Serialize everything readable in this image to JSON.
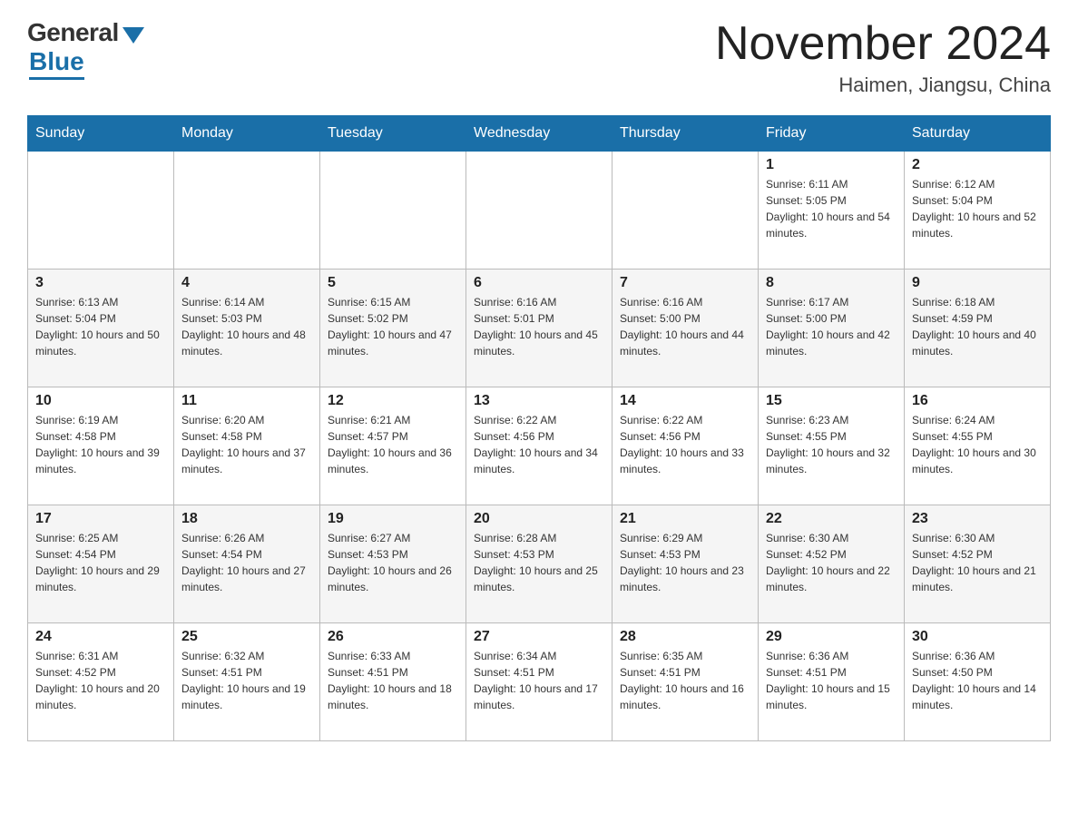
{
  "logo": {
    "general": "General",
    "blue": "Blue"
  },
  "title": "November 2024",
  "location": "Haimen, Jiangsu, China",
  "weekdays": [
    "Sunday",
    "Monday",
    "Tuesday",
    "Wednesday",
    "Thursday",
    "Friday",
    "Saturday"
  ],
  "weeks": [
    [
      {
        "day": "",
        "info": ""
      },
      {
        "day": "",
        "info": ""
      },
      {
        "day": "",
        "info": ""
      },
      {
        "day": "",
        "info": ""
      },
      {
        "day": "",
        "info": ""
      },
      {
        "day": "1",
        "info": "Sunrise: 6:11 AM\nSunset: 5:05 PM\nDaylight: 10 hours and 54 minutes."
      },
      {
        "day": "2",
        "info": "Sunrise: 6:12 AM\nSunset: 5:04 PM\nDaylight: 10 hours and 52 minutes."
      }
    ],
    [
      {
        "day": "3",
        "info": "Sunrise: 6:13 AM\nSunset: 5:04 PM\nDaylight: 10 hours and 50 minutes."
      },
      {
        "day": "4",
        "info": "Sunrise: 6:14 AM\nSunset: 5:03 PM\nDaylight: 10 hours and 48 minutes."
      },
      {
        "day": "5",
        "info": "Sunrise: 6:15 AM\nSunset: 5:02 PM\nDaylight: 10 hours and 47 minutes."
      },
      {
        "day": "6",
        "info": "Sunrise: 6:16 AM\nSunset: 5:01 PM\nDaylight: 10 hours and 45 minutes."
      },
      {
        "day": "7",
        "info": "Sunrise: 6:16 AM\nSunset: 5:00 PM\nDaylight: 10 hours and 44 minutes."
      },
      {
        "day": "8",
        "info": "Sunrise: 6:17 AM\nSunset: 5:00 PM\nDaylight: 10 hours and 42 minutes."
      },
      {
        "day": "9",
        "info": "Sunrise: 6:18 AM\nSunset: 4:59 PM\nDaylight: 10 hours and 40 minutes."
      }
    ],
    [
      {
        "day": "10",
        "info": "Sunrise: 6:19 AM\nSunset: 4:58 PM\nDaylight: 10 hours and 39 minutes."
      },
      {
        "day": "11",
        "info": "Sunrise: 6:20 AM\nSunset: 4:58 PM\nDaylight: 10 hours and 37 minutes."
      },
      {
        "day": "12",
        "info": "Sunrise: 6:21 AM\nSunset: 4:57 PM\nDaylight: 10 hours and 36 minutes."
      },
      {
        "day": "13",
        "info": "Sunrise: 6:22 AM\nSunset: 4:56 PM\nDaylight: 10 hours and 34 minutes."
      },
      {
        "day": "14",
        "info": "Sunrise: 6:22 AM\nSunset: 4:56 PM\nDaylight: 10 hours and 33 minutes."
      },
      {
        "day": "15",
        "info": "Sunrise: 6:23 AM\nSunset: 4:55 PM\nDaylight: 10 hours and 32 minutes."
      },
      {
        "day": "16",
        "info": "Sunrise: 6:24 AM\nSunset: 4:55 PM\nDaylight: 10 hours and 30 minutes."
      }
    ],
    [
      {
        "day": "17",
        "info": "Sunrise: 6:25 AM\nSunset: 4:54 PM\nDaylight: 10 hours and 29 minutes."
      },
      {
        "day": "18",
        "info": "Sunrise: 6:26 AM\nSunset: 4:54 PM\nDaylight: 10 hours and 27 minutes."
      },
      {
        "day": "19",
        "info": "Sunrise: 6:27 AM\nSunset: 4:53 PM\nDaylight: 10 hours and 26 minutes."
      },
      {
        "day": "20",
        "info": "Sunrise: 6:28 AM\nSunset: 4:53 PM\nDaylight: 10 hours and 25 minutes."
      },
      {
        "day": "21",
        "info": "Sunrise: 6:29 AM\nSunset: 4:53 PM\nDaylight: 10 hours and 23 minutes."
      },
      {
        "day": "22",
        "info": "Sunrise: 6:30 AM\nSunset: 4:52 PM\nDaylight: 10 hours and 22 minutes."
      },
      {
        "day": "23",
        "info": "Sunrise: 6:30 AM\nSunset: 4:52 PM\nDaylight: 10 hours and 21 minutes."
      }
    ],
    [
      {
        "day": "24",
        "info": "Sunrise: 6:31 AM\nSunset: 4:52 PM\nDaylight: 10 hours and 20 minutes."
      },
      {
        "day": "25",
        "info": "Sunrise: 6:32 AM\nSunset: 4:51 PM\nDaylight: 10 hours and 19 minutes."
      },
      {
        "day": "26",
        "info": "Sunrise: 6:33 AM\nSunset: 4:51 PM\nDaylight: 10 hours and 18 minutes."
      },
      {
        "day": "27",
        "info": "Sunrise: 6:34 AM\nSunset: 4:51 PM\nDaylight: 10 hours and 17 minutes."
      },
      {
        "day": "28",
        "info": "Sunrise: 6:35 AM\nSunset: 4:51 PM\nDaylight: 10 hours and 16 minutes."
      },
      {
        "day": "29",
        "info": "Sunrise: 6:36 AM\nSunset: 4:51 PM\nDaylight: 10 hours and 15 minutes."
      },
      {
        "day": "30",
        "info": "Sunrise: 6:36 AM\nSunset: 4:50 PM\nDaylight: 10 hours and 14 minutes."
      }
    ]
  ]
}
